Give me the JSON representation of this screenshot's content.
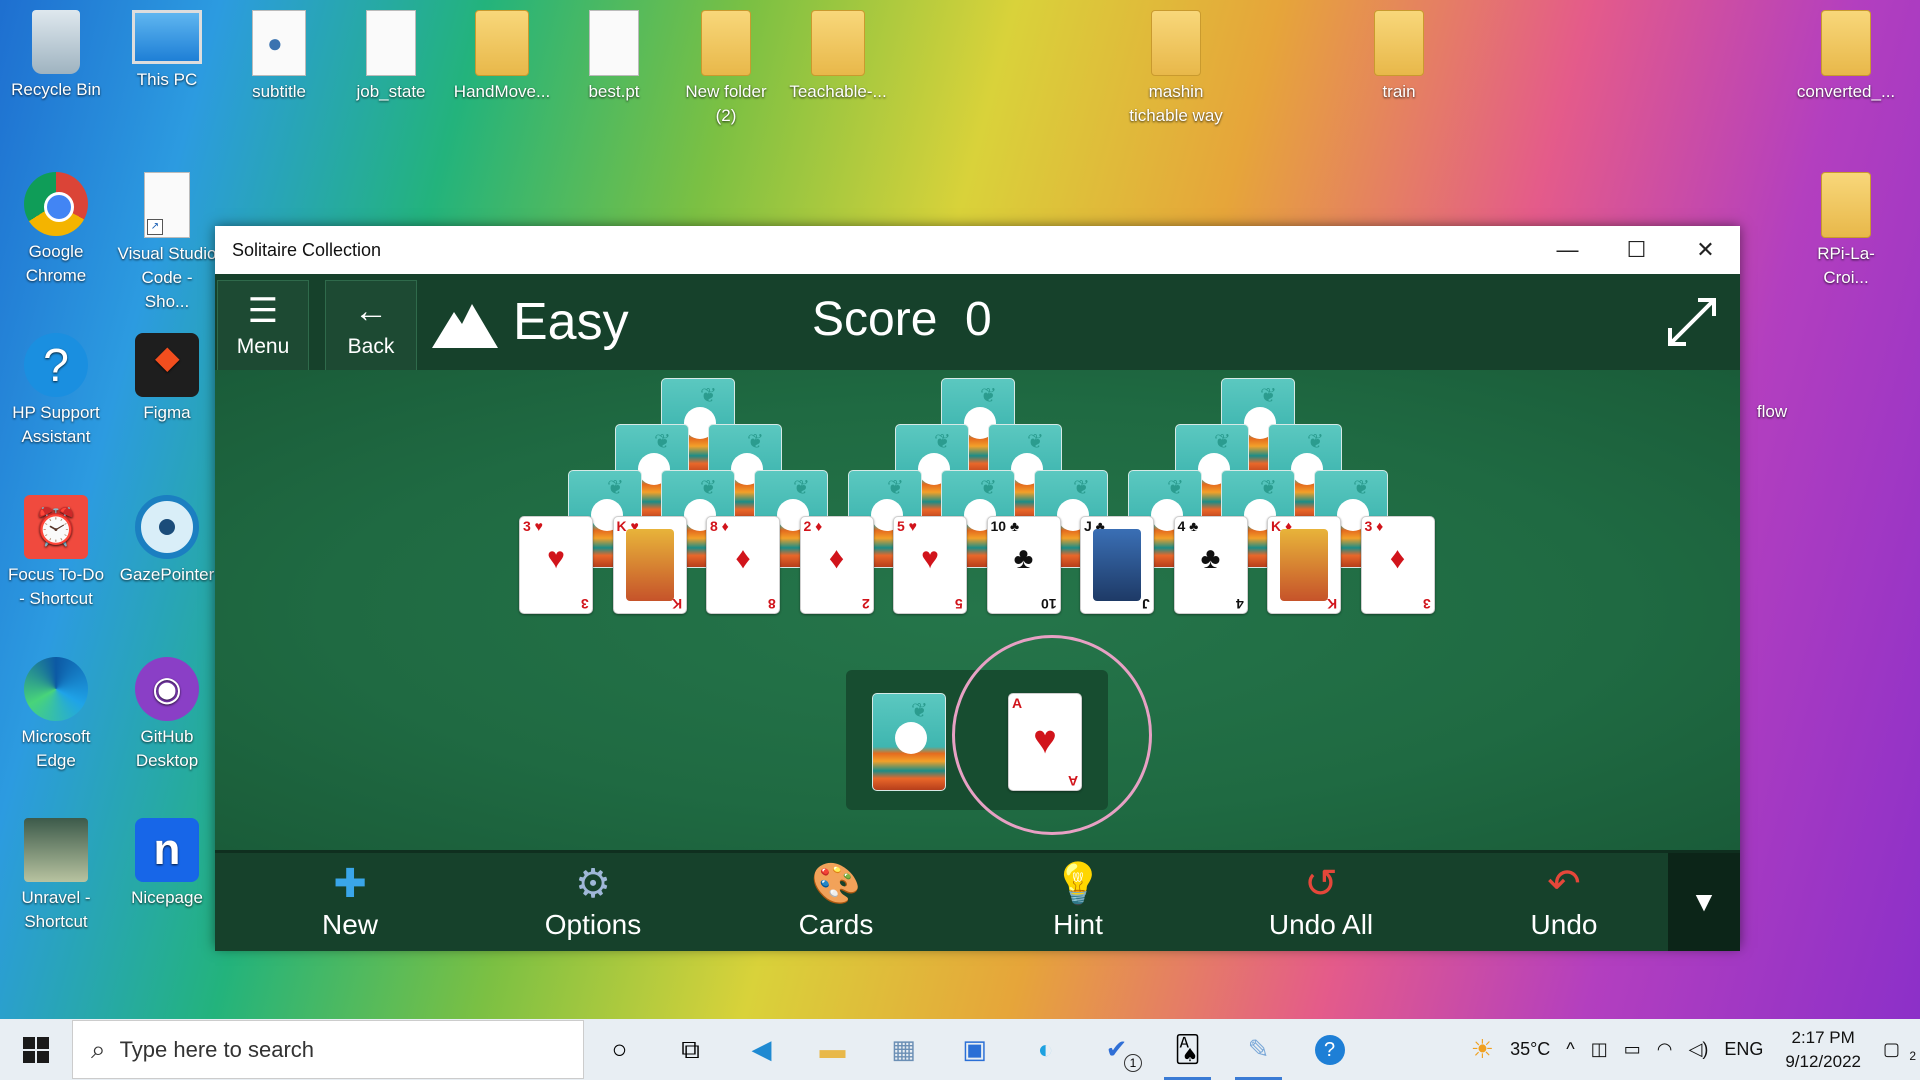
{
  "desktop": {
    "icons": [
      {
        "label": "Recycle Bin"
      },
      {
        "label": "This PC"
      },
      {
        "label": "subtitle"
      },
      {
        "label": "job_state"
      },
      {
        "label": "HandMove..."
      },
      {
        "label": "best.pt"
      },
      {
        "label": "New folder (2)"
      },
      {
        "label": "Teachable-..."
      },
      {
        "label": "mashin tichable way"
      },
      {
        "label": "train"
      },
      {
        "label": "converted_..."
      },
      {
        "label": "Google Chrome"
      },
      {
        "label": "Visual Studio Code - Sho..."
      },
      {
        "label": "RPi-La-Croi..."
      },
      {
        "label": "HP Support Assistant"
      },
      {
        "label": "Figma"
      },
      {
        "label": "flow"
      },
      {
        "label": "Focus To-Do - Shortcut"
      },
      {
        "label": "GazePointer"
      },
      {
        "label": "Microsoft Edge"
      },
      {
        "label": "GitHub Desktop"
      },
      {
        "label": "Unravel - Shortcut"
      },
      {
        "label": "Nicepage"
      }
    ]
  },
  "window": {
    "title": "Solitaire Collection",
    "toolbar": {
      "menu_label": "Menu",
      "back_label": "Back",
      "mode": "Easy",
      "score_label": "Score",
      "score_value": "0"
    },
    "tableau_face_row": [
      {
        "rank": "3",
        "suit": "♥",
        "color": "red"
      },
      {
        "rank": "K",
        "suit": "♥",
        "color": "red",
        "court": true
      },
      {
        "rank": "8",
        "suit": "♦",
        "color": "red"
      },
      {
        "rank": "2",
        "suit": "♦",
        "color": "red"
      },
      {
        "rank": "5",
        "suit": "♥",
        "color": "red"
      },
      {
        "rank": "10",
        "suit": "♣",
        "color": "black"
      },
      {
        "rank": "J",
        "suit": "♣",
        "color": "black",
        "court": true
      },
      {
        "rank": "4",
        "suit": "♣",
        "color": "black"
      },
      {
        "rank": "K",
        "suit": "♦",
        "color": "red",
        "court": true
      },
      {
        "rank": "3",
        "suit": "♦",
        "color": "red"
      }
    ],
    "waste_card": {
      "rank": "A",
      "suit": "♥",
      "color": "red"
    },
    "bottom_bar": {
      "new_label": "New",
      "options_label": "Options",
      "cards_label": "Cards",
      "hint_label": "Hint",
      "undo_all_label": "Undo All",
      "undo_label": "Undo"
    }
  },
  "taskbar": {
    "search_placeholder": "Type here to search",
    "weather": "35°C",
    "language": "ENG",
    "time": "2:17 PM",
    "date": "9/12/2022",
    "notification_count": "2",
    "todo_badge": "1"
  },
  "colors": {
    "felt": "#1f6a42",
    "toolbar": "#16412b",
    "highlight_ring": "#e7a1c4"
  }
}
